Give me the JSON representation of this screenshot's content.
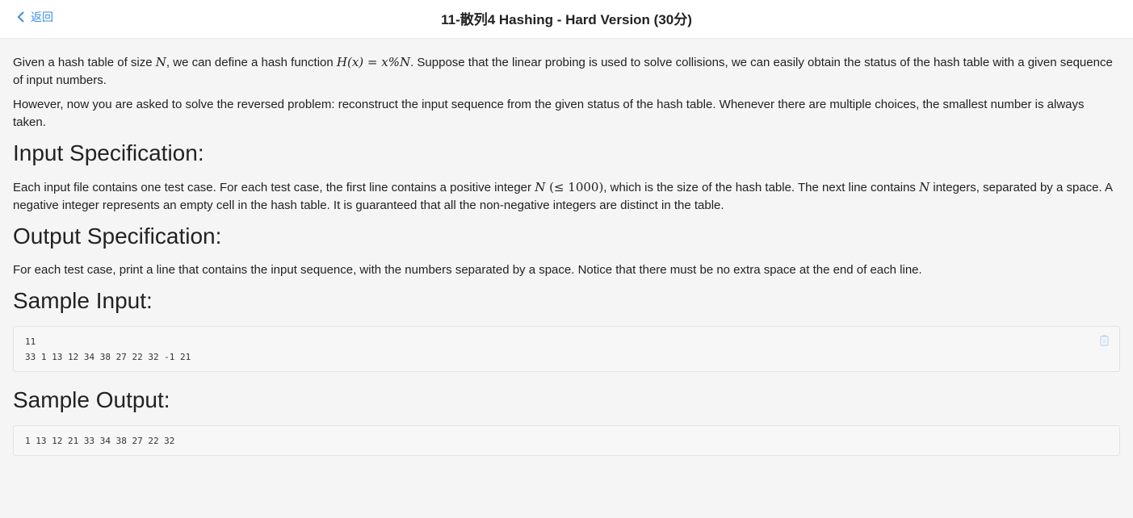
{
  "header": {
    "back_label": "返回",
    "title": "11-散列4 Hashing - Hard Version (30分)"
  },
  "problem": {
    "intro": {
      "t1": "Given a hash table of size ",
      "m1": "N",
      "t2": ", we can define a hash function ",
      "m2": "H(x) = x%N",
      "t3": ". Suppose that the linear probing is used to solve collisions, we can easily obtain the status of the hash table with a given sequence of input numbers."
    },
    "para2": "However, now you are asked to solve the reversed problem: reconstruct the input sequence from the given status of the hash table. Whenever there are multiple choices, the smallest number is always taken.",
    "input_heading": "Input Specification:",
    "input_spec": {
      "t1": "Each input file contains one test case. For each test case, the first line contains a positive integer ",
      "m1": "N",
      "m1b": " (≤ 1000)",
      "t2": ", which is the size of the hash table. The next line contains ",
      "m2": "N",
      "t3": " integers, separated by a space. A negative integer represents an empty cell in the hash table. It is guaranteed that all the non-negative integers are distinct in the table."
    },
    "output_heading": "Output Specification:",
    "output_spec": "For each test case, print a line that contains the input sequence, with the numbers separated by a space. Notice that there must be no extra space at the end of each line.",
    "sample_input_heading": "Sample Input:",
    "sample_input": "11\n33 1 13 12 34 38 27 22 32 -1 21",
    "sample_output_heading": "Sample Output:",
    "sample_output": "1 13 12 21 33 34 38 27 22 32"
  },
  "icons": {
    "back": "chevron-left-icon",
    "copy": "copy-icon"
  },
  "colors": {
    "accent": "#3a8ee6",
    "background": "#f5f5f5",
    "header_bg": "#ffffff"
  }
}
